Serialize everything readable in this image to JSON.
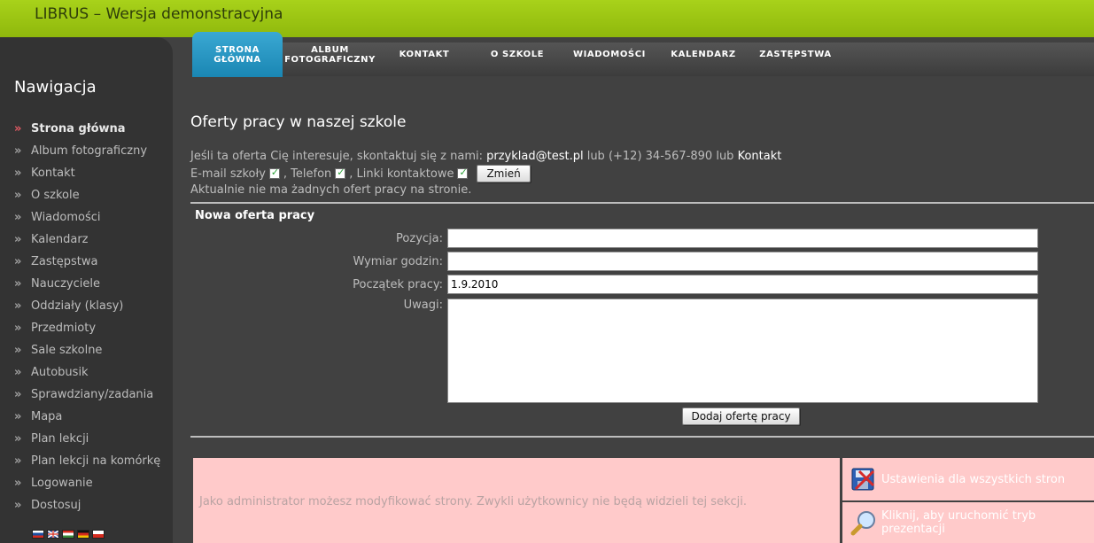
{
  "header": {
    "title": "LIBRUS – Wersja demonstracyjna"
  },
  "sidebar": {
    "heading": "Nawigacja",
    "items": [
      {
        "label": "Strona główna",
        "active": true
      },
      {
        "label": "Album fotograficzny"
      },
      {
        "label": "Kontakt"
      },
      {
        "label": "O szkole"
      },
      {
        "label": "Wiadomości"
      },
      {
        "label": "Kalendarz"
      },
      {
        "label": "Zastępstwa"
      },
      {
        "label": "Nauczyciele"
      },
      {
        "label": "Oddziały (klasy)"
      },
      {
        "label": "Przedmioty"
      },
      {
        "label": "Sale szkolne"
      },
      {
        "label": "Autobusik"
      },
      {
        "label": "Sprawdziany/zadania"
      },
      {
        "label": "Mapa"
      },
      {
        "label": "Plan lekcji"
      },
      {
        "label": "Plan lekcji na komórkę"
      },
      {
        "label": "Logowanie"
      },
      {
        "label": "Dostosuj"
      }
    ],
    "flags": [
      "flag-sk-icon",
      "flag-uk-icon",
      "flag-hu-icon",
      "flag-de-icon",
      "flag-pl-icon"
    ]
  },
  "topnav": {
    "tabs": [
      {
        "line1": "STRONA",
        "line2": "GŁÓWNA",
        "active": true
      },
      {
        "line1": "ALBUM",
        "line2": "FOTOGRAFICZNY"
      },
      {
        "line1": "KONTAKT",
        "line2": ""
      },
      {
        "line1": "O SZKOLE",
        "line2": ""
      },
      {
        "line1": "WIADOMOŚCI",
        "line2": ""
      },
      {
        "line1": "KALENDARZ",
        "line2": ""
      },
      {
        "line1": "ZASTĘPSTWA",
        "line2": ""
      }
    ]
  },
  "main": {
    "title": "Oferty pracy w naszej szkole",
    "contact_prefix": "Jeśli ta oferta Cię interesuje, skontaktuj się z nami:",
    "email": "przyklad@test.pl",
    "lub1": "lub (+12) 34-567-890 lub",
    "contact_link": "Kontakt",
    "opt_email": "E-mail szkoły",
    "opt_phone": ", Telefon",
    "opt_links": ", Linki kontaktowe",
    "change_btn": "Zmień",
    "no_offers": "Aktualnie nie ma żadnych ofert pracy na stronie."
  },
  "form": {
    "title": "Nowa oferta pracy",
    "position_label": "Pozycja:",
    "position_value": "",
    "hours_label": "Wymiar godzin:",
    "hours_value": "",
    "start_label": "Początek pracy:",
    "start_value": "1.9.2010",
    "notes_label": "Uwagi:",
    "notes_value": "",
    "submit": "Dodaj ofertę pracy"
  },
  "admin": {
    "notice": "Jako administrator możesz modyfikować strony. Zwykli użytkownicy nie będą widzieli tej sekcji.",
    "settings_label": "Ustawienia dla wszystkich stron",
    "presentation_label": "Kliknij, aby uruchomić tryb prezentacji"
  },
  "colors": {
    "accent": "#1a86b3",
    "header": "#9cc414",
    "admin_bg": "#ffcaca"
  }
}
